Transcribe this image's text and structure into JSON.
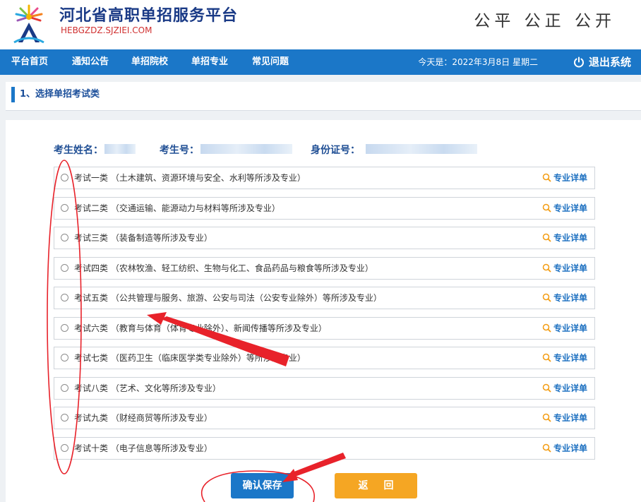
{
  "header": {
    "title": "河北省高职单招服务平台",
    "url": "HEBGZDZ.SJZIEI.COM",
    "slogan": "公平 公正 公开"
  },
  "nav": {
    "items": [
      "平台首页",
      "通知公告",
      "单招院校",
      "单招专业",
      "常见问题"
    ],
    "date_text": "今天是：2022年3月8日 星期二",
    "logout_label": "退出系统"
  },
  "step": {
    "title": "1、选择单招考试类"
  },
  "candidate": {
    "name_label": "考生姓名：",
    "number_label": "考生号：",
    "id_label": "身份证号："
  },
  "exam_options": [
    {
      "label": "考试一类 （土木建筑、资源环境与安全、水利等所涉及专业）",
      "detail": "专业详单"
    },
    {
      "label": "考试二类 （交通运输、能源动力与材料等所涉及专业）",
      "detail": "专业详单"
    },
    {
      "label": "考试三类 （装备制造等所涉及专业）",
      "detail": "专业详单"
    },
    {
      "label": "考试四类 （农林牧渔、轻工纺织、生物与化工、食品药品与粮食等所涉及专业）",
      "detail": "专业详单"
    },
    {
      "label": "考试五类 （公共管理与服务、旅游、公安与司法（公安专业除外）等所涉及专业）",
      "detail": "专业详单"
    },
    {
      "label": "考试六类 （教育与体育（体育专业除外）、新闻传播等所涉及专业）",
      "detail": "专业详单"
    },
    {
      "label": "考试七类 （医药卫生（临床医学类专业除外）等所涉及专业）",
      "detail": "专业详单"
    },
    {
      "label": "考试八类 （艺术、文化等所涉及专业）",
      "detail": "专业详单"
    },
    {
      "label": "考试九类 （财经商贸等所涉及专业）",
      "detail": "专业详单"
    },
    {
      "label": "考试十类 （电子信息等所涉及专业）",
      "detail": "专业详单"
    }
  ],
  "buttons": {
    "save": "确认保存",
    "back": "返回"
  },
  "colors": {
    "primary": "#1b77c8",
    "back_button": "#f5a623",
    "annotation": "#e8222a"
  }
}
